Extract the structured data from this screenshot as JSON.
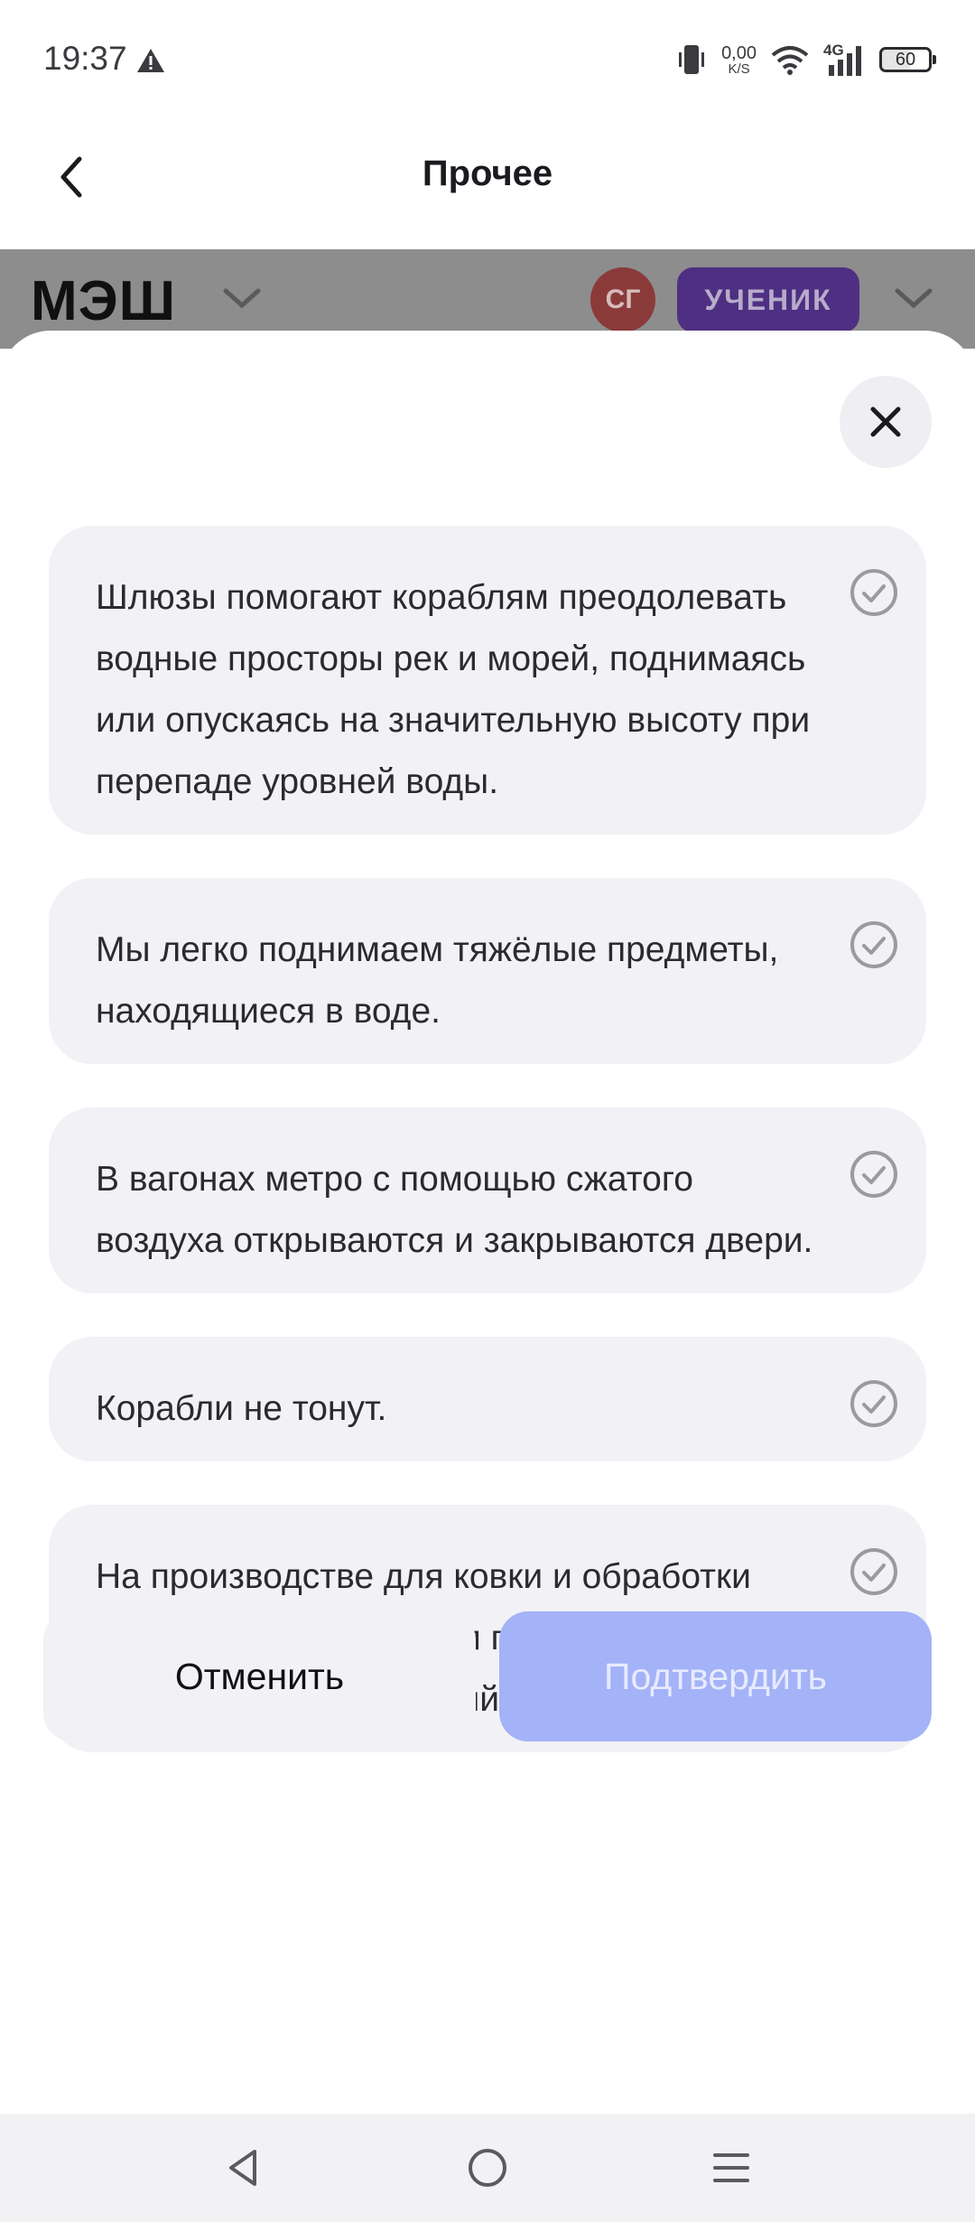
{
  "status_bar": {
    "time": "19:37",
    "net_speed_value": "0,00",
    "net_speed_unit": "K/S",
    "network_type": "4G",
    "battery_level": "60"
  },
  "header": {
    "title": "Прочее"
  },
  "background_app": {
    "logo": "МЭШ",
    "avatar_initials": "СГ",
    "role": "УЧЕНИК"
  },
  "options": [
    {
      "text": "Шлюзы помогают кораблям преодолевать водные просторы рек и морей, поднимаясь или опускаясь на значительную высоту при перепаде уровней воды."
    },
    {
      "text": "Мы легко поднимаем тяжёлые предметы, находящиеся в воде."
    },
    {
      "text": "В вагонах метро с помощью сжатого воздуха открываются и закрываются двери."
    },
    {
      "text": "Корабли не тонут."
    },
    {
      "text": "На производстве для ковки и обработки металлов используется пневматический молот и пневматический пресс."
    }
  ],
  "actions": {
    "cancel_label": "Отменить",
    "confirm_label": "Подтвердить"
  },
  "colors": {
    "accent_disabled": "#a4b2f7",
    "role_badge": "#4e2f83",
    "avatar": "#8b3a3a",
    "card_background": "#f2f2f6"
  }
}
